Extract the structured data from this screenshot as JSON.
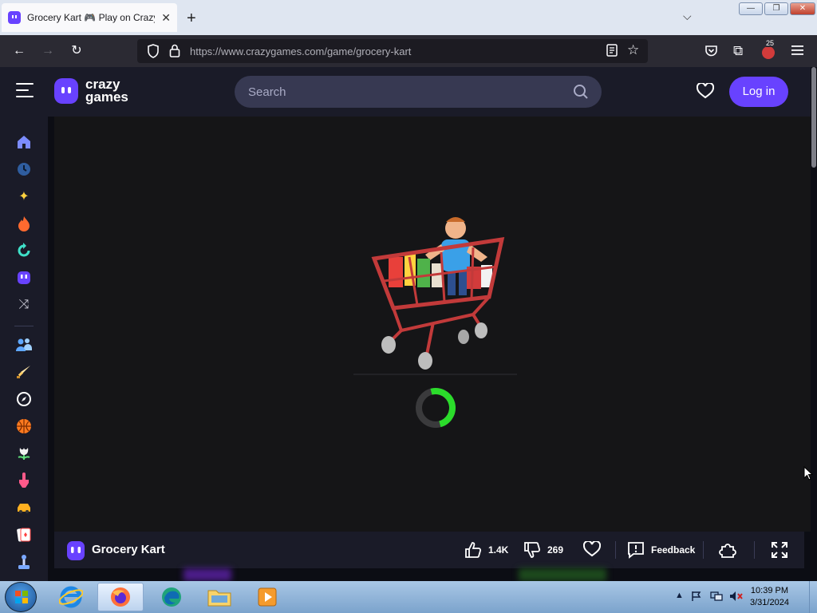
{
  "browser": {
    "tab_title": "Grocery Kart 🎮 Play on CrazyGames",
    "url": "https://www.crazygames.com/game/grocery-kart",
    "extensions_badge": "25"
  },
  "site": {
    "logo_line1": "crazy",
    "logo_line2": "games",
    "search_placeholder": "Search",
    "login_label": "Log in",
    "brand_color": "#6842ff"
  },
  "sidebar": {
    "items": [
      {
        "name": "home",
        "color": "#7c8cff"
      },
      {
        "name": "recent",
        "color": "#2f5d9f"
      },
      {
        "name": "new",
        "color": "#ffd23f"
      },
      {
        "name": "trending",
        "color": "#ff6a2f"
      },
      {
        "name": "updated",
        "color": "#3fe0c8"
      },
      {
        "name": "originals",
        "color": "#6842ff"
      },
      {
        "name": "random",
        "color": "#c9c9d4"
      },
      {
        "name": "multiplayer",
        "color": "#5fa8ff"
      },
      {
        "name": "action",
        "color": "#ffcc66"
      },
      {
        "name": "adventure",
        "color": "#ffffff"
      },
      {
        "name": "basketball",
        "color": "#ff7a1f"
      },
      {
        "name": "casual",
        "color": "#5fdd7a"
      },
      {
        "name": "clicker",
        "color": "#ff5a8a"
      },
      {
        "name": "driving",
        "color": "#ffb020"
      },
      {
        "name": "card",
        "color": "#ff4040"
      },
      {
        "name": "controller",
        "color": "#7aa8ff"
      }
    ]
  },
  "game": {
    "title": "Grocery Kart",
    "likes": "1.4K",
    "dislikes": "269",
    "feedback_label": "Feedback"
  },
  "taskbar": {
    "time": "10:39 PM",
    "date": "3/31/2024"
  }
}
